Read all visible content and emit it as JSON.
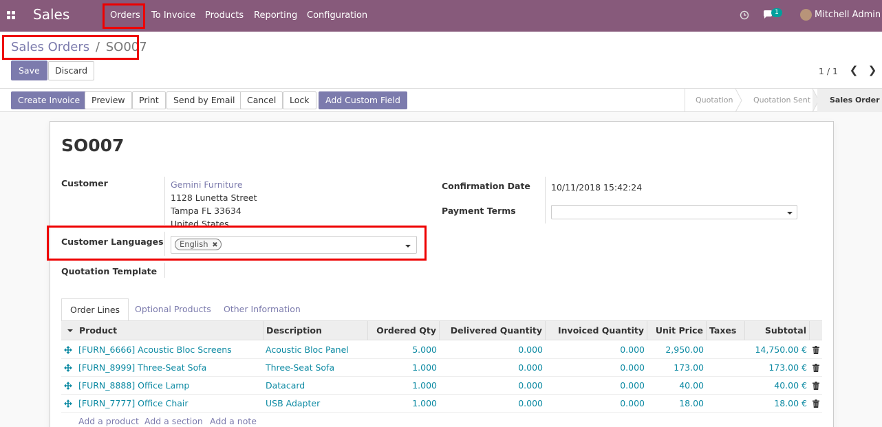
{
  "navbar": {
    "brand": "Sales",
    "menu": [
      "Orders",
      "To Invoice",
      "Products",
      "Reporting",
      "Configuration"
    ],
    "chat_count": "1",
    "user": "Mitchell Admin"
  },
  "breadcrumb": {
    "parent": "Sales Orders",
    "separator": "/",
    "current": "SO007"
  },
  "actions": {
    "save": "Save",
    "discard": "Discard"
  },
  "pager": {
    "text": "1 / 1"
  },
  "buttons": [
    "Create Invoice",
    "Preview",
    "Print",
    "Send by Email",
    "Cancel",
    "Lock",
    "Add Custom Field"
  ],
  "stages": [
    "Quotation",
    "Quotation Sent",
    "Sales Order"
  ],
  "form": {
    "title": "SO007",
    "customer_label": "Customer",
    "customer_name": "Gemini Furniture",
    "address": [
      "1128 Lunetta Street",
      "Tampa FL 33634",
      "United States"
    ],
    "languages_label": "Customer Languages",
    "language_tag": "English",
    "template_label": "Quotation Template",
    "confirmation_label": "Confirmation Date",
    "confirmation_value": "10/11/2018 15:42:24",
    "payment_label": "Payment Terms"
  },
  "tabs": [
    "Order Lines",
    "Optional Products",
    "Other Information"
  ],
  "table": {
    "headers": [
      "Product",
      "Description",
      "Ordered Qty",
      "Delivered Quantity",
      "Invoiced Quantity",
      "Unit Price",
      "Taxes",
      "Subtotal"
    ],
    "rows": [
      [
        "[FURN_6666] Acoustic Bloc Screens",
        "Acoustic Bloc Panel",
        "5.000",
        "0.000",
        "0.000",
        "2,950.00",
        "",
        "14,750.00 €"
      ],
      [
        "[FURN_8999] Three-Seat Sofa",
        "Three-Seat Sofa",
        "1.000",
        "0.000",
        "0.000",
        "173.00",
        "",
        "173.00 €"
      ],
      [
        "[FURN_8888] Office Lamp",
        "Datacard",
        "1.000",
        "0.000",
        "0.000",
        "40.00",
        "",
        "40.00 €"
      ],
      [
        "[FURN_7777] Office Chair",
        "USB Adapter",
        "1.000",
        "0.000",
        "0.000",
        "18.00",
        "",
        "18.00 €"
      ]
    ]
  },
  "add_links": [
    "Add a product",
    "Add a section",
    "Add a note"
  ],
  "colors": {
    "brand": "#875a7b",
    "accent": "#7c7bad",
    "link": "#0d8aa3",
    "highlight": "#e00000"
  }
}
